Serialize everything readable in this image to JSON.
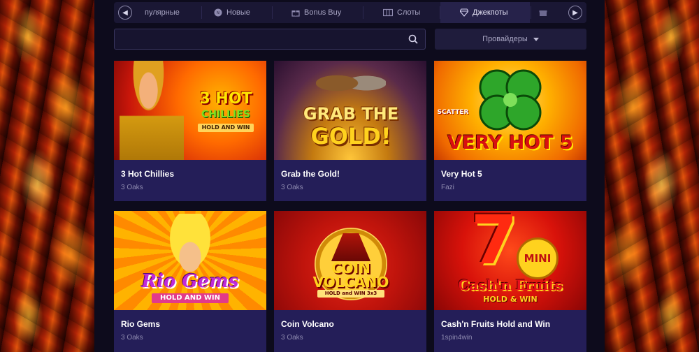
{
  "tabs": [
    {
      "label": "пулярные",
      "icon": "star-icon"
    },
    {
      "label": "Новые",
      "icon": "new-badge-icon"
    },
    {
      "label": "Bonus Buy",
      "icon": "gift-icon"
    },
    {
      "label": "Слоты",
      "icon": "slot-machine-icon"
    },
    {
      "label": "Джекпоты",
      "icon": "diamond-icon",
      "active": true
    },
    {
      "label": "",
      "icon": "gift-partial-icon"
    }
  ],
  "search": {
    "value": "",
    "placeholder": ""
  },
  "providers": {
    "label": "Провайдеры"
  },
  "games": [
    {
      "title": "3 Hot Chillies",
      "provider": "3 Oaks",
      "art_lines": [
        "3 HOT",
        "CHILLIES",
        "HOLD AND WIN"
      ]
    },
    {
      "title": "Grab the Gold!",
      "provider": "3 Oaks",
      "art_lines": [
        "GRAB THE",
        "GOLD!"
      ]
    },
    {
      "title": "Very Hot 5",
      "provider": "Fazi",
      "art_lines": [
        "VERY HOT 5",
        "SCATTER"
      ]
    },
    {
      "title": "Rio Gems",
      "provider": "3 Oaks",
      "art_lines": [
        "Rio Gems",
        "HOLD AND WIN"
      ]
    },
    {
      "title": "Coin Volcano",
      "provider": "3 Oaks",
      "art_lines": [
        "COIN",
        "VOLCANO",
        "HOLD and WIN 3x3"
      ]
    },
    {
      "title": "Cash'n Fruits Hold and Win",
      "provider": "1spin4win",
      "art_lines": [
        "7",
        "MINI",
        "Cash'n Fruits",
        "HOLD & WIN"
      ]
    }
  ]
}
